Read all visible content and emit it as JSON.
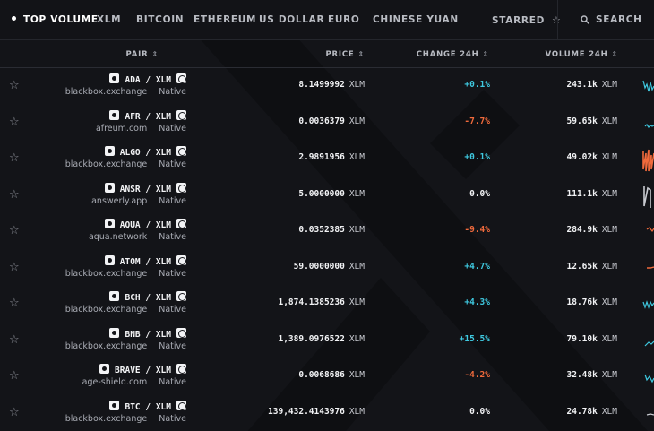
{
  "nav": {
    "tabs": [
      "TOP VOLUME",
      "XLM",
      "BITCOIN",
      "ETHEREUM",
      "US DOLLAR",
      "EURO",
      "CHINESE YUAN"
    ],
    "starred_label": "STARRED",
    "search_label": "SEARCH"
  },
  "table": {
    "headers": {
      "pair": "PAIR",
      "price": "PRICE",
      "change": "CHANGE 24H",
      "volume": "VOLUME 24H"
    },
    "rows": [
      {
        "base": "ADA",
        "quote": "XLM",
        "domain": "blackbox.exchange",
        "native": "Native",
        "price": "8.1499992",
        "price_unit": "XLM",
        "change": "+0.1%",
        "trend": "up",
        "volume": "243.1k",
        "volume_unit": "XLM",
        "spark_color": "#3fc9e0"
      },
      {
        "base": "AFR",
        "quote": "XLM",
        "domain": "afreum.com",
        "native": "Native",
        "price": "0.0036379",
        "price_unit": "XLM",
        "change": "-7.7%",
        "trend": "down",
        "volume": "59.65k",
        "volume_unit": "XLM",
        "spark_color": "#3fc9e0"
      },
      {
        "base": "ALGO",
        "quote": "XLM",
        "domain": "blackbox.exchange",
        "native": "Native",
        "price": "2.9891956",
        "price_unit": "XLM",
        "change": "+0.1%",
        "trend": "up",
        "volume": "49.02k",
        "volume_unit": "XLM",
        "spark_color": "#f06a3c"
      },
      {
        "base": "ANSR",
        "quote": "XLM",
        "domain": "answerly.app",
        "native": "Native",
        "price": "5.0000000",
        "price_unit": "XLM",
        "change": "0.0%",
        "trend": "flat",
        "volume": "111.1k",
        "volume_unit": "XLM",
        "spark_color": "#c8cad0"
      },
      {
        "base": "AQUA",
        "quote": "XLM",
        "domain": "aqua.network",
        "native": "Native",
        "price": "0.0352385",
        "price_unit": "XLM",
        "change": "-9.4%",
        "trend": "down",
        "volume": "284.9k",
        "volume_unit": "XLM",
        "spark_color": "#f06a3c"
      },
      {
        "base": "ATOM",
        "quote": "XLM",
        "domain": "blackbox.exchange",
        "native": "Native",
        "price": "59.0000000",
        "price_unit": "XLM",
        "change": "+4.7%",
        "trend": "up",
        "volume": "12.65k",
        "volume_unit": "XLM",
        "spark_color": "#f06a3c"
      },
      {
        "base": "BCH",
        "quote": "XLM",
        "domain": "blackbox.exchange",
        "native": "Native",
        "price": "1,874.1385236",
        "price_unit": "XLM",
        "change": "+4.3%",
        "trend": "up",
        "volume": "18.76k",
        "volume_unit": "XLM",
        "spark_color": "#3fc9e0"
      },
      {
        "base": "BNB",
        "quote": "XLM",
        "domain": "blackbox.exchange",
        "native": "Native",
        "price": "1,389.0976522",
        "price_unit": "XLM",
        "change": "+15.5%",
        "trend": "up",
        "volume": "79.10k",
        "volume_unit": "XLM",
        "spark_color": "#3fc9e0"
      },
      {
        "base": "BRAVE",
        "quote": "XLM",
        "domain": "age-shield.com",
        "native": "Native",
        "price": "0.0068686",
        "price_unit": "XLM",
        "change": "-4.2%",
        "trend": "down",
        "volume": "32.48k",
        "volume_unit": "XLM",
        "spark_color": "#3fc9e0"
      },
      {
        "base": "BTC",
        "quote": "XLM",
        "domain": "blackbox.exchange",
        "native": "Native",
        "price": "139,432.4143976",
        "price_unit": "XLM",
        "change": "0.0%",
        "trend": "flat",
        "volume": "24.78k",
        "volume_unit": "XLM",
        "spark_color": "#c8cad0"
      }
    ]
  },
  "colors": {
    "up": "#3fc9e0",
    "down": "#f06a3c",
    "flat": "#f2f3f5",
    "background": "#131418"
  }
}
